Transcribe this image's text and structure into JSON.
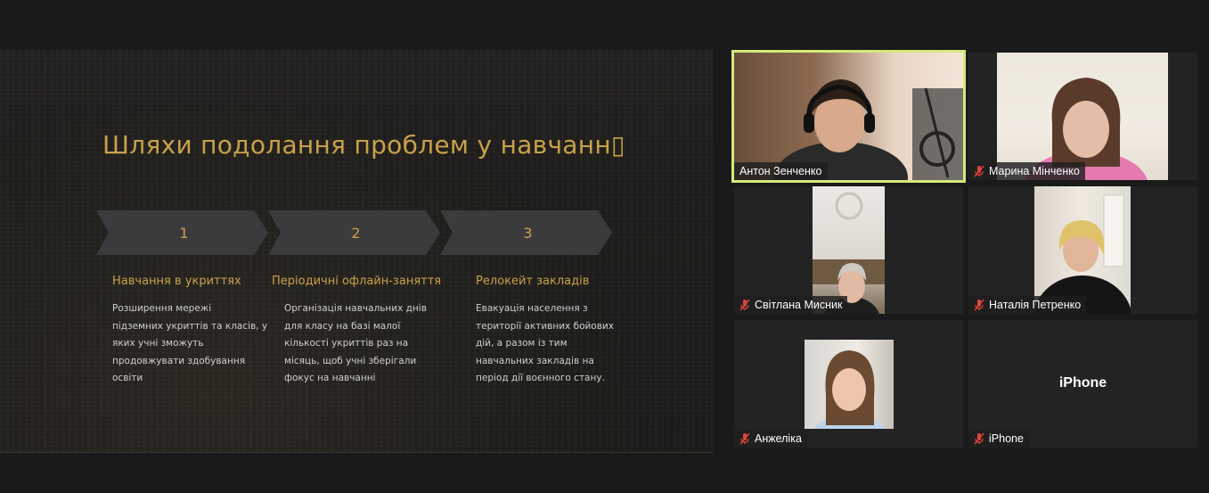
{
  "slide": {
    "title": "Шляхи подолання проблем у навчанн▯",
    "steps": [
      {
        "number": "1",
        "heading": "Навчання в укриттях",
        "body": [
          "Розширення мережі",
          "підземних укриттів та класів, у",
          "яких учні зможуть",
          "продовжувати здобування",
          "освіти"
        ]
      },
      {
        "number": "2",
        "heading": "Періодичні офлайн-заняття",
        "body": [
          "Організація навчальних днів",
          "для класу на базі малої",
          "кількості укриттів раз на",
          "місяць, щоб учні зберігали",
          "фокус на навчанні"
        ]
      },
      {
        "number": "3",
        "heading": "Релокейт закладів",
        "body": [
          "Евакуація населення з",
          "території активних бойових",
          "дій, а разом із тим",
          "навчальних закладів на",
          "період дії воєнного стану."
        ]
      }
    ]
  },
  "participants": [
    {
      "name": "Антон Зенченко",
      "muted": false,
      "active": true,
      "video": true,
      "icon": "participant-video"
    },
    {
      "name": "Марина Мінченко",
      "muted": true,
      "active": false,
      "video": true,
      "icon": "participant-video"
    },
    {
      "name": "Світлана Мисник",
      "muted": true,
      "active": false,
      "video": true,
      "icon": "participant-video"
    },
    {
      "name": "Наталія Петренко",
      "muted": true,
      "active": false,
      "video": true,
      "icon": "participant-video"
    },
    {
      "name": "Анжеліка",
      "muted": true,
      "active": false,
      "video": true,
      "icon": "participant-video"
    },
    {
      "name": "iPhone",
      "muted": true,
      "active": false,
      "video": false,
      "center_label": "iPhone"
    }
  ],
  "colors": {
    "accent_gold": "#c9a14a",
    "active_speaker": "#d6e97a",
    "muted_red": "#e0443a",
    "background": "#1a1a1a"
  }
}
